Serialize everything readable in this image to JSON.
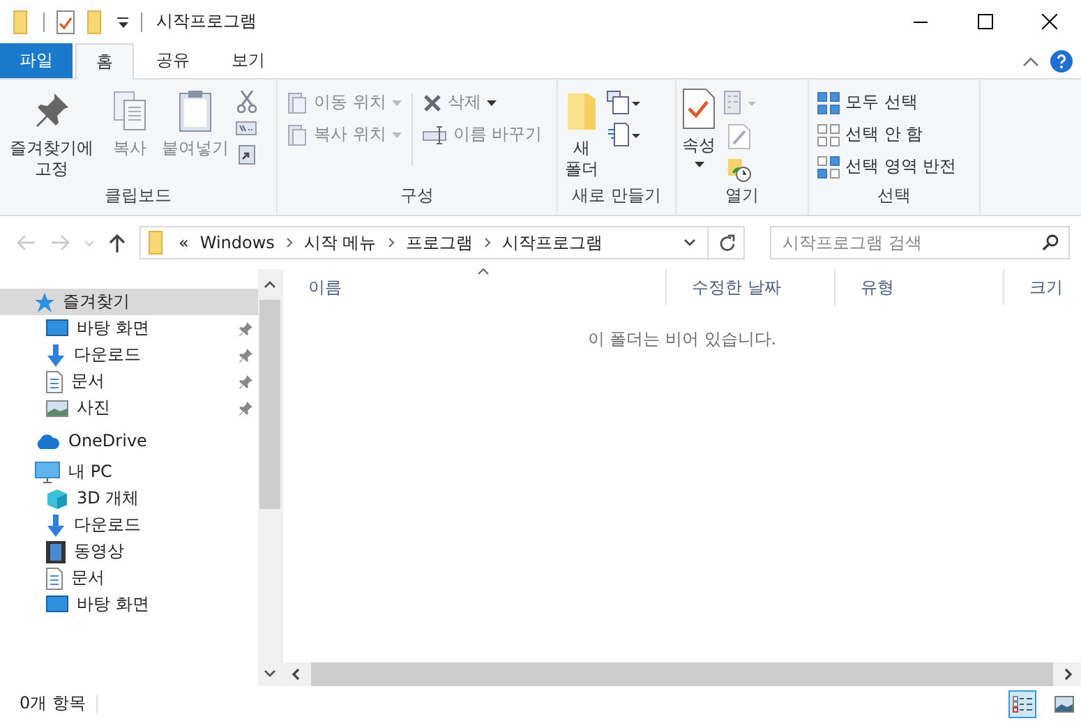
{
  "window": {
    "title": "시작프로그램"
  },
  "ribbon_tabs": [
    {
      "label": "파일",
      "kind": "file",
      "selected": false
    },
    {
      "label": "홈",
      "kind": "tab",
      "selected": true
    },
    {
      "label": "공유",
      "kind": "tab",
      "selected": false
    },
    {
      "label": "보기",
      "kind": "tab",
      "selected": false
    }
  ],
  "ribbon_groups": [
    {
      "label": "클립보드",
      "commands": [
        {
          "label": "즐겨찾기에 고정",
          "disabled": false
        },
        {
          "label": "복사",
          "disabled": true
        },
        {
          "label": "붙여넣기",
          "disabled": true
        }
      ]
    },
    {
      "label": "구성",
      "commands": [
        {
          "label": "이동 위치",
          "disabled": true
        },
        {
          "label": "복사 위치",
          "disabled": true
        },
        {
          "label": "삭제",
          "disabled": true
        },
        {
          "label": "이름 바꾸기",
          "disabled": true
        }
      ]
    },
    {
      "label": "새로 만들기",
      "commands": [
        {
          "label": "새 폴더",
          "disabled": false
        }
      ]
    },
    {
      "label": "열기",
      "commands": [
        {
          "label": "속성",
          "disabled": false
        }
      ]
    },
    {
      "label": "선택",
      "commands": [
        {
          "label": "모두 선택",
          "disabled": false
        },
        {
          "label": "선택 안 함",
          "disabled": false
        },
        {
          "label": "선택 영역 반전",
          "disabled": false
        }
      ]
    }
  ],
  "address": {
    "overflow": "«",
    "crumbs": [
      "Windows",
      "시작 메뉴",
      "프로그램",
      "시작프로그램"
    ]
  },
  "search": {
    "placeholder": "시작프로그램 검색"
  },
  "nav_tree": [
    {
      "label": "즐겨찾기",
      "selected": true,
      "children": [
        {
          "label": "바탕 화면",
          "pinned": true
        },
        {
          "label": "다운로드",
          "pinned": true
        },
        {
          "label": "문서",
          "pinned": true
        },
        {
          "label": "사진",
          "pinned": true
        }
      ]
    },
    {
      "label": "OneDrive",
      "selected": false
    },
    {
      "label": "내 PC",
      "selected": false,
      "children": [
        {
          "label": "3D 개체",
          "pinned": false
        },
        {
          "label": "다운로드",
          "pinned": false
        },
        {
          "label": "동영상",
          "pinned": false
        },
        {
          "label": "문서",
          "pinned": false
        },
        {
          "label": "바탕 화면",
          "pinned": false
        }
      ]
    }
  ],
  "columns": [
    {
      "label": "이름",
      "sorted": true
    },
    {
      "label": "수정한 날짜",
      "sorted": false
    },
    {
      "label": "유형",
      "sorted": false
    },
    {
      "label": "크기",
      "sorted": false
    }
  ],
  "empty_message": "이 폴더는 비어 있습니다.",
  "status_bar": {
    "item_count": "0개 항목",
    "views": [
      {
        "kind": "details",
        "selected": true
      },
      {
        "kind": "large",
        "selected": false
      }
    ]
  }
}
